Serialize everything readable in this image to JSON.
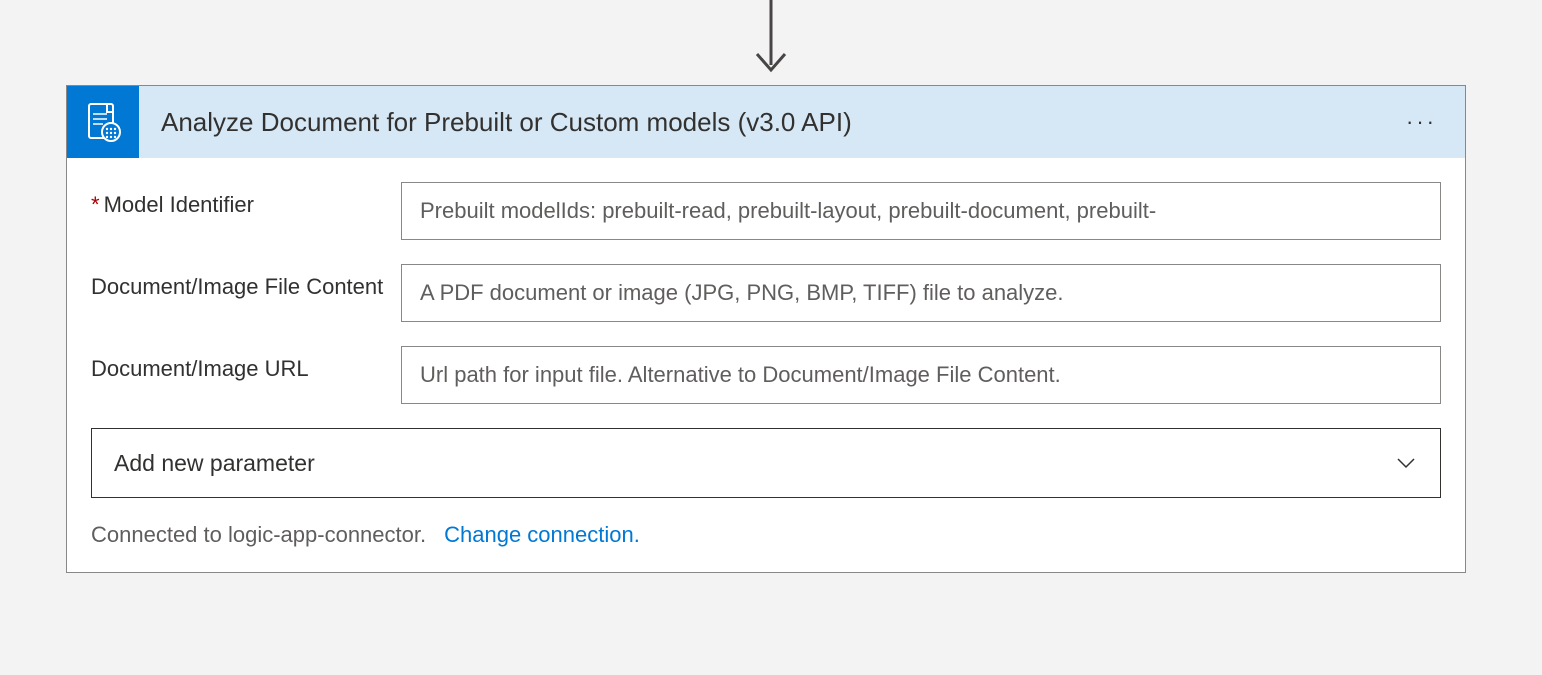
{
  "header": {
    "title": "Analyze Document for Prebuilt or Custom models (v3.0 API)"
  },
  "fields": {
    "modelIdentifier": {
      "label": "Model Identifier",
      "required": true,
      "placeholder": "Prebuilt modelIds: prebuilt-read, prebuilt-layout, prebuilt-document, prebuilt-"
    },
    "fileContent": {
      "label": "Document/Image File Content",
      "required": false,
      "placeholder": "A PDF document or image (JPG, PNG, BMP, TIFF) file to analyze."
    },
    "url": {
      "label": "Document/Image URL",
      "required": false,
      "placeholder": "Url path for input file. Alternative to Document/Image File Content."
    }
  },
  "dropdown": {
    "label": "Add new parameter"
  },
  "footer": {
    "connectedText": "Connected to logic-app-connector.",
    "changeLink": "Change connection."
  }
}
